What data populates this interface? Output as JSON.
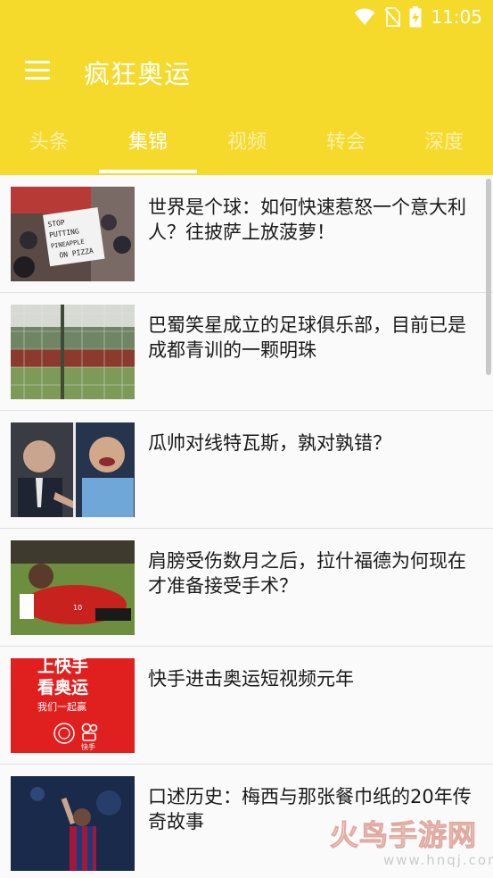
{
  "status_bar": {
    "time": "11:05",
    "icons": [
      "wifi-icon",
      "no-sim-icon",
      "battery-charging-icon"
    ]
  },
  "app_bar": {
    "menu_icon": "hamburger-menu-icon",
    "title": "疯狂奥运"
  },
  "tabs": [
    {
      "label": "头条",
      "active": false
    },
    {
      "label": "集锦",
      "active": true
    },
    {
      "label": "视频",
      "active": false
    },
    {
      "label": "转会",
      "active": false
    },
    {
      "label": "深度",
      "active": false
    }
  ],
  "articles": [
    {
      "title": "世界是个球：如何快速惹怒一个意大利人？往披萨上放菠萝！",
      "image_text": "STOP PUTTING PINEAPPLE ON PIZZA"
    },
    {
      "title": "巴蜀笑星成立的足球俱乐部，目前已是成都青训的一颗明珠"
    },
    {
      "title": "瓜帅对线特瓦斯，孰对孰错？"
    },
    {
      "title": "肩膀受伤数月之后，拉什福德为何现在才准备接受手术？"
    },
    {
      "title": "快手进击奥运短视频元年",
      "image_text": {
        "line1": "上快手",
        "line2": "看奥运",
        "line3": "我们一起赢",
        "brand": "快手"
      }
    },
    {
      "title": "口述历史：梅西与那张餐巾纸的20年传奇故事"
    }
  ],
  "watermark": {
    "text": "火鸟手游网",
    "url": "www.hnqj.com"
  },
  "colors": {
    "primary": "#f5d92b",
    "text": "#1a1a1a",
    "card": "#fafafa"
  }
}
